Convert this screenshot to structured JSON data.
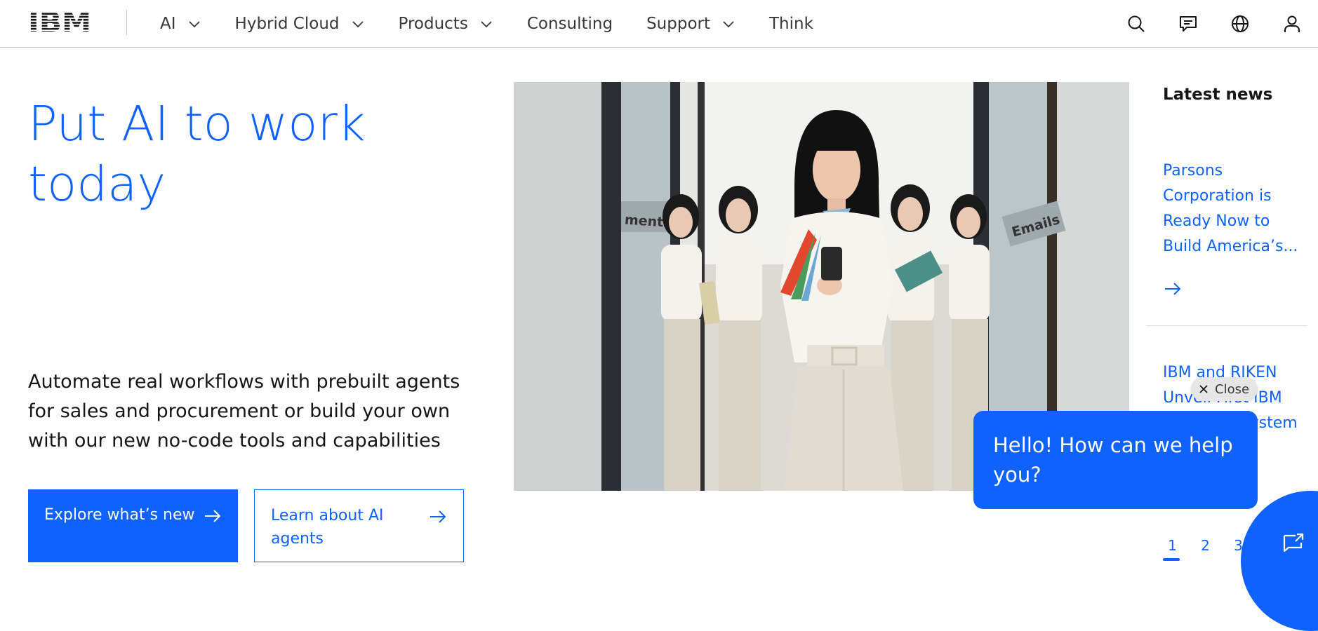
{
  "masthead": {
    "logo_text": "IBM",
    "nav": [
      {
        "label": "AI",
        "has_menu": true
      },
      {
        "label": "Hybrid Cloud",
        "has_menu": true
      },
      {
        "label": "Products",
        "has_menu": true
      },
      {
        "label": "Consulting",
        "has_menu": false
      },
      {
        "label": "Support",
        "has_menu": true
      },
      {
        "label": "Think",
        "has_menu": false
      }
    ],
    "actions": [
      "search-icon",
      "chat-icon",
      "globe-icon",
      "user-icon"
    ]
  },
  "hero": {
    "title": "Put AI to work today",
    "description": "Automate real workflows with prebuilt agents for sales and procurement or build your own with our new no-code tools and capabilities",
    "primary_button": "Explore what’s new",
    "secondary_button": "Learn about AI agents",
    "image_signage": {
      "left": "ments",
      "right": "Emails"
    }
  },
  "news": {
    "heading": "Latest news",
    "items": [
      {
        "title": "Parsons Corporation is Ready Now to Build America’s..."
      },
      {
        "title": "IBM and RIKEN Unveil First IBM Quantum System Two of..."
      }
    ],
    "pages": [
      "1",
      "2",
      "3"
    ],
    "active_page": "1"
  },
  "chat": {
    "close_label": "Close",
    "greeting": "Hello! How can we help you?"
  },
  "colors": {
    "accent": "#0f62fe",
    "text": "#161616",
    "border": "#c6c6c6"
  }
}
